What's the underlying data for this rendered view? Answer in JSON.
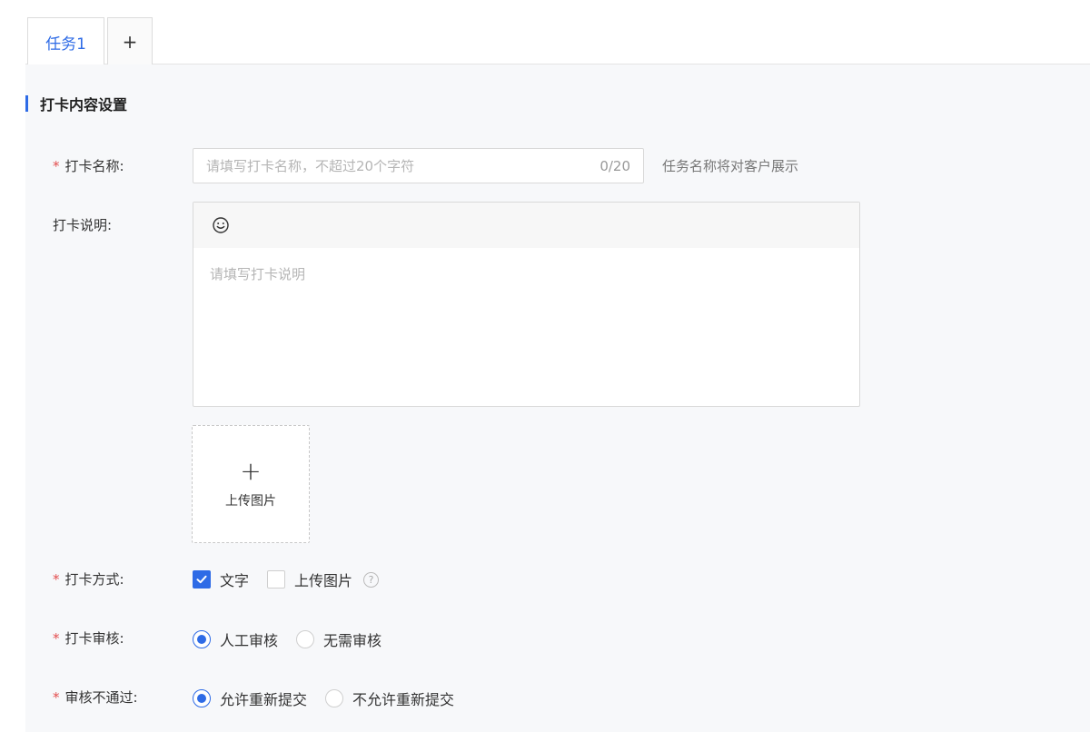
{
  "tabs": {
    "active_label": "任务1",
    "add_label": "+"
  },
  "section": {
    "title": "打卡内容设置"
  },
  "form": {
    "required_mark": "*",
    "name_label": "打卡名称:",
    "name_placeholder": "请填写打卡名称，不超过20个字符",
    "name_count": "0/20",
    "name_hint": "任务名称将对客户展示",
    "desc_label": "打卡说明:",
    "desc_placeholder": "请填写打卡说明",
    "upload_plus": "+",
    "upload_label": "上传图片",
    "method_label": "打卡方式:",
    "method_options": [
      {
        "label": "文字",
        "checked": true
      },
      {
        "label": "上传图片",
        "checked": false
      }
    ],
    "help_glyph": "?",
    "review_label": "打卡审核:",
    "review_options": [
      {
        "label": "人工审核",
        "checked": true
      },
      {
        "label": "无需审核",
        "checked": false
      }
    ],
    "reject_label": "审核不通过:",
    "reject_options": [
      {
        "label": "允许重新提交",
        "checked": true
      },
      {
        "label": "不允许重新提交",
        "checked": false
      }
    ]
  },
  "colors": {
    "accent": "#2e6be6",
    "required": "#e34d4d"
  },
  "icons": {
    "emoji": "smiley-icon",
    "check": "checkmark-icon",
    "help": "question-circle-icon"
  }
}
